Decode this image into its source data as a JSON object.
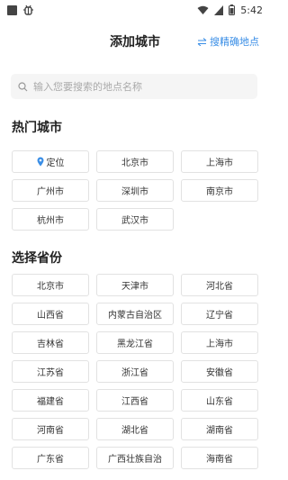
{
  "status_bar": {
    "time": "5:42",
    "app_icon": "bug-icon"
  },
  "header": {
    "title": "添加城市",
    "precise_link": "搜精确地点",
    "precise_icon": "swap-arrows-icon"
  },
  "search": {
    "placeholder": "输入您要搜索的地点名称",
    "value": ""
  },
  "hot_cities": {
    "title": "热门城市",
    "items": [
      "定位",
      "北京市",
      "上海市",
      "广州市",
      "深圳市",
      "南京市",
      "杭州市",
      "武汉市"
    ]
  },
  "provinces": {
    "title": "选择省份",
    "items": [
      "北京市",
      "天津市",
      "河北省",
      "山西省",
      "内蒙古自治区",
      "辽宁省",
      "吉林省",
      "黑龙江省",
      "上海市",
      "江苏省",
      "浙江省",
      "安徽省",
      "福建省",
      "江西省",
      "山东省",
      "河南省",
      "湖北省",
      "湖南省",
      "广东省",
      "广西壮族自治",
      "海南省"
    ]
  },
  "colors": {
    "accent": "#3a8ee6",
    "border": "#e2e2e2",
    "search_bg": "#f5f5f5"
  }
}
